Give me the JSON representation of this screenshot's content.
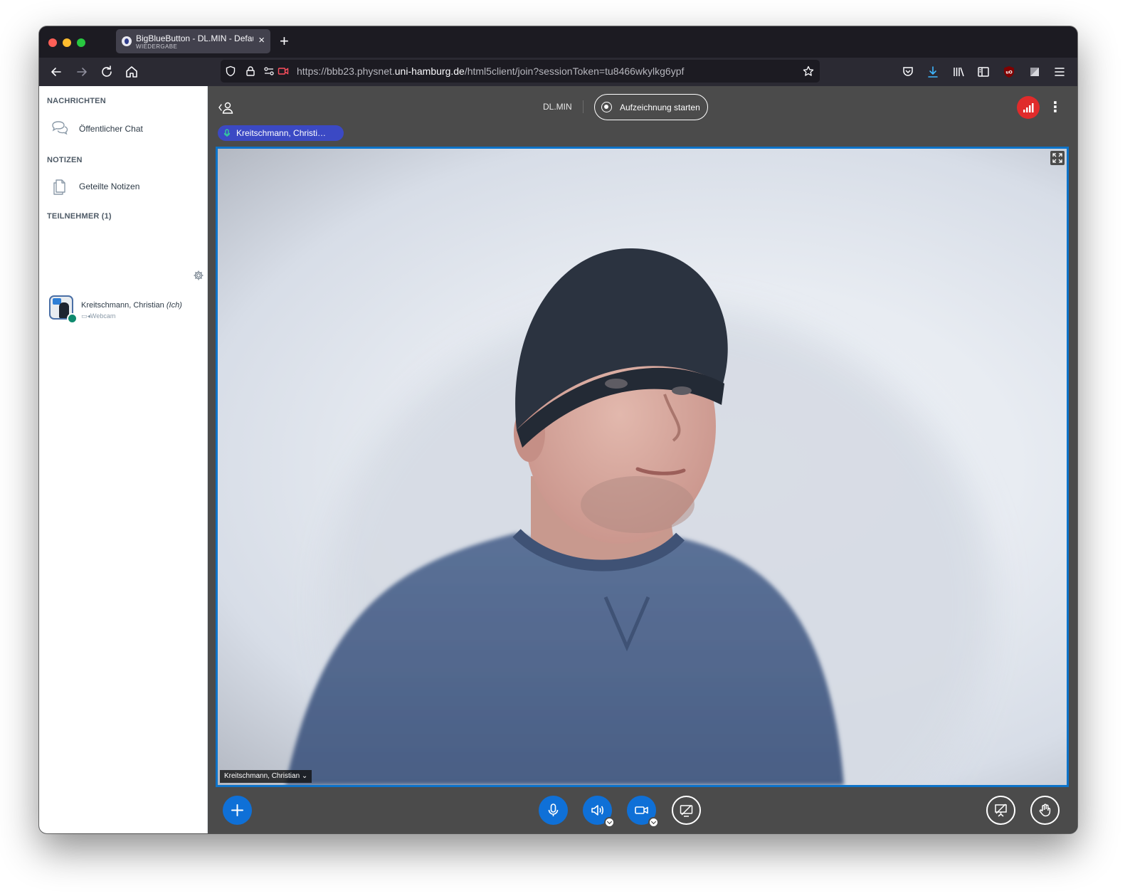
{
  "browser": {
    "tab_title": "BigBlueButton - DL.MIN - Default",
    "tab_subtitle": "WIEDERGABE",
    "url_prefix": "https://bbb23.physnet.",
    "url_domain": "uni-hamburg.de",
    "url_path": "/html5client/join?sessionToken=tu8466wkylkg6ypf"
  },
  "sidebar": {
    "messages_title": "NACHRICHTEN",
    "public_chat": "Öffentlicher Chat",
    "notes_title": "NOTIZEN",
    "shared_notes": "Geteilte Notizen",
    "participants_title": "TEILNEHMER (1)",
    "user_name": "Kreitschmann, Christian",
    "user_self": "(Ich)",
    "user_status": "Webcam"
  },
  "main": {
    "meeting_name": "DL.MIN",
    "record_label": "Aufzeichnung starten",
    "talker": "Kreitschmann, Christi…",
    "video_label": "Kreitschmann, Christian ⌄"
  },
  "colors": {
    "accent": "#0f70d7",
    "record_indicator": "#e02b2b",
    "talker_badge": "#3b49c4"
  },
  "icons": [
    "shield-icon",
    "lock-icon",
    "camera-blocked-icon",
    "star-icon",
    "pocket-icon",
    "download-icon",
    "library-icon",
    "sidebar-icon",
    "ublock-icon",
    "extension-icon",
    "menu-icon",
    "chat-icon",
    "notes-icon",
    "gear-icon",
    "mic-icon",
    "speaker-icon",
    "video-icon",
    "screen-share-icon",
    "presentation-icon",
    "hand-icon",
    "plus-icon",
    "fullscreen-icon"
  ]
}
